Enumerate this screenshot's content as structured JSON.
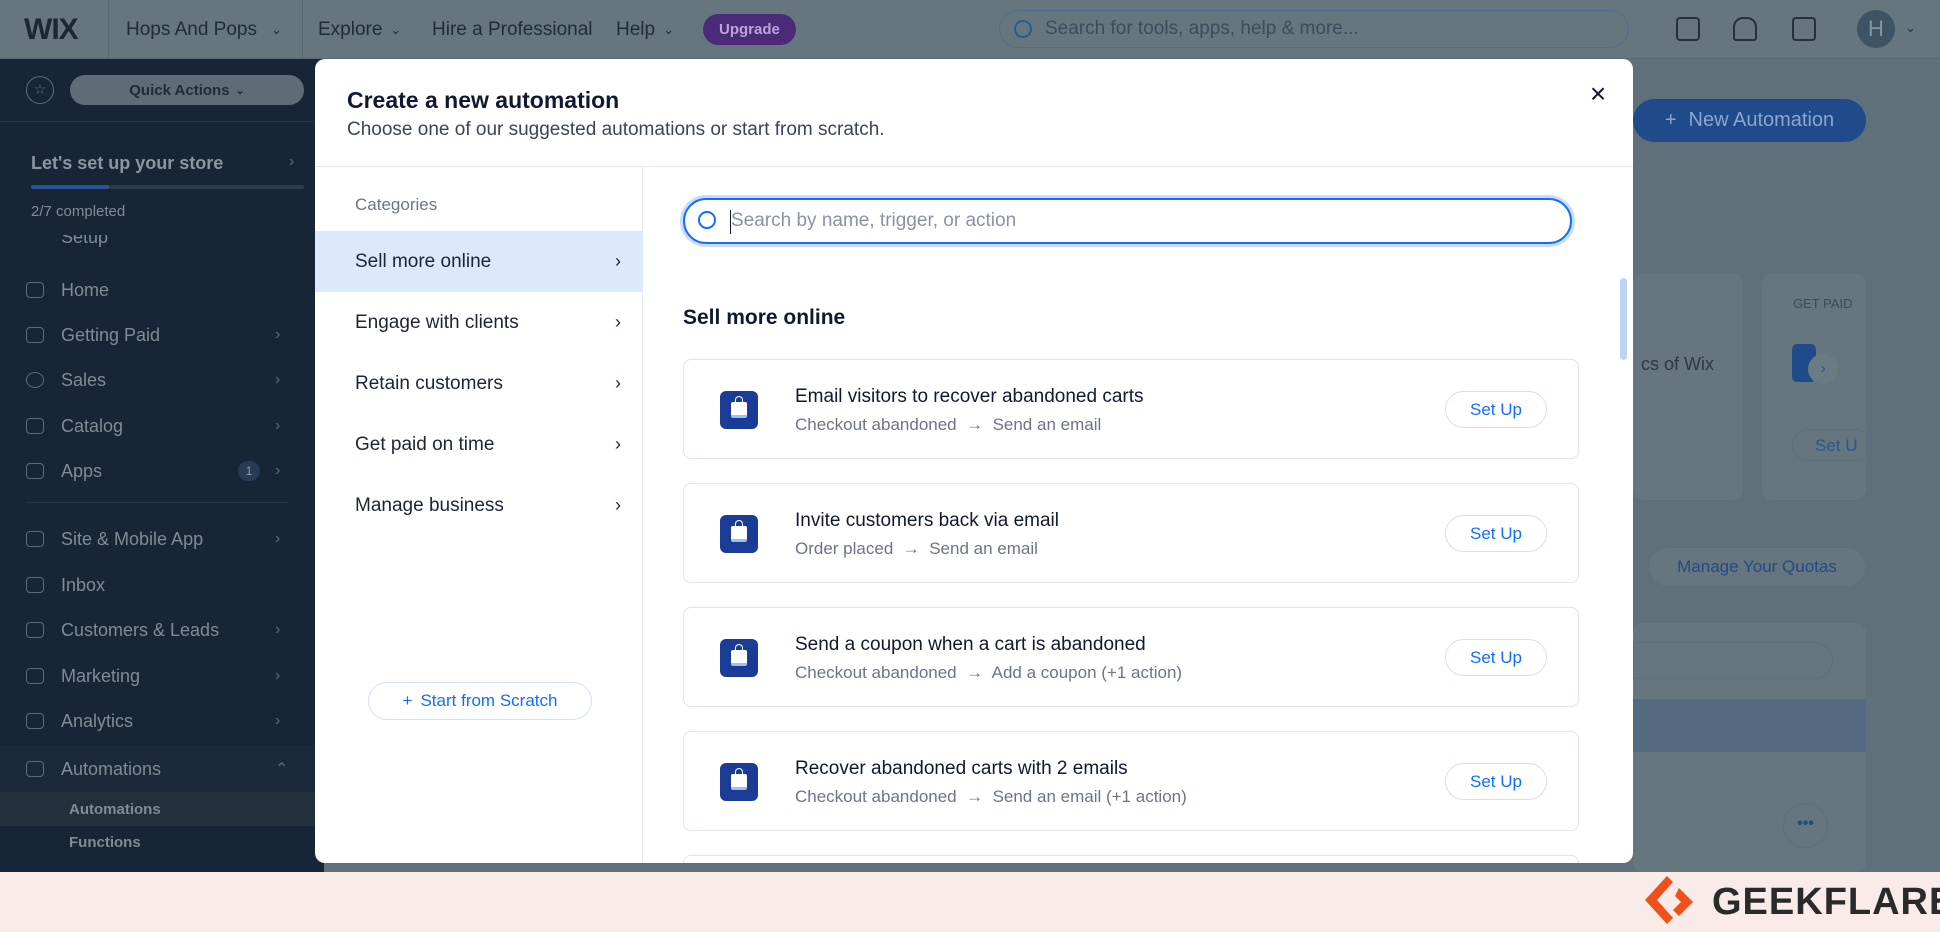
{
  "topbar": {
    "logo": "WIX",
    "site_name": "Hops And Pops",
    "nav": [
      "Explore",
      "Hire a Professional",
      "Help"
    ],
    "upgrade": "Upgrade",
    "search_placeholder": "Search for tools, apps, help & more...",
    "avatar_initial": "H"
  },
  "sidebar": {
    "quick_actions": "Quick Actions",
    "setup_title": "Let's set up your store",
    "progress": "2/7 completed",
    "progress_fraction": 0.2857,
    "items": [
      {
        "label": "Setup"
      },
      {
        "label": "Home"
      },
      {
        "label": "Getting Paid"
      },
      {
        "label": "Sales"
      },
      {
        "label": "Catalog"
      },
      {
        "label": "Apps",
        "badge": "1"
      },
      {
        "label": "Site & Mobile App"
      },
      {
        "label": "Inbox"
      },
      {
        "label": "Customers & Leads"
      },
      {
        "label": "Marketing"
      },
      {
        "label": "Analytics"
      },
      {
        "label": "Automations"
      }
    ],
    "subitems": [
      "Automations",
      "Functions"
    ]
  },
  "background": {
    "new_automation": "New Automation",
    "card_text": "cs of Wix",
    "get_paid": "GET PAID",
    "setup_partial": "Set U",
    "manage_quotas": "Manage Your Quotas"
  },
  "modal": {
    "title": "Create a new automation",
    "subtitle": "Choose one of our suggested automations or start from scratch.",
    "close": "×",
    "categories_label": "Categories",
    "categories": [
      "Sell more online",
      "Engage with clients",
      "Retain customers",
      "Get paid on time",
      "Manage business"
    ],
    "selected_category": "Sell more online",
    "start_from_scratch": "Start from Scratch",
    "search_placeholder": "Search by name, trigger, or action",
    "section_title": "Sell more online",
    "cards": [
      {
        "title": "Email visitors to recover abandoned carts",
        "trigger": "Checkout abandoned",
        "action": "Send an email",
        "button": "Set Up"
      },
      {
        "title": "Invite customers back via email",
        "trigger": "Order placed",
        "action": "Send an email",
        "button": "Set Up"
      },
      {
        "title": "Send a coupon when a cart is abandoned",
        "trigger": "Checkout abandoned",
        "action": "Add a coupon  (+1 action)",
        "button": "Set Up"
      },
      {
        "title": "Recover abandoned carts with 2 emails",
        "trigger": "Checkout abandoned",
        "action": "Send an email  (+1 action)",
        "button": "Set Up"
      }
    ]
  },
  "watermark": "GEEKFLARE",
  "colors": {
    "accent": "#116dff",
    "selected_category": "#dbe8fd",
    "icon_bg": "#1a3c96",
    "upgrade": "#4b2a7a",
    "watermark_orange": "#f0501a"
  }
}
